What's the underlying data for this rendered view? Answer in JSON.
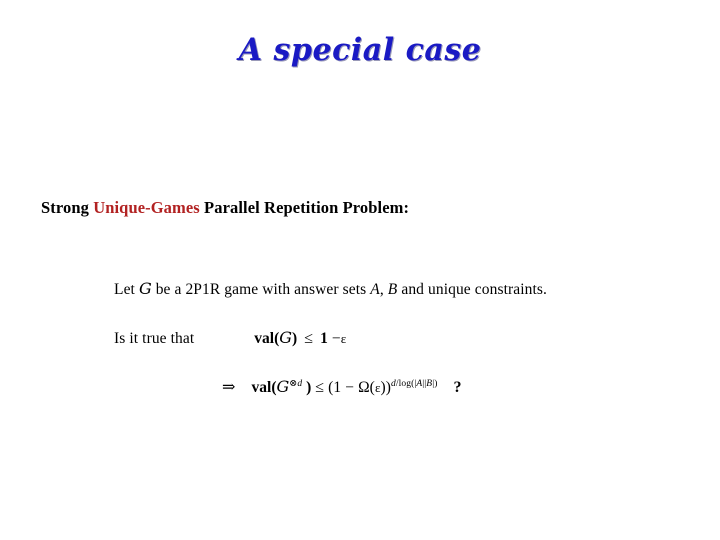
{
  "slide": {
    "background_color": "#ffffff",
    "title": {
      "text": "A special case",
      "color": "#1a1ac4",
      "shadow_color": "#9a9ab8"
    },
    "heading": {
      "prefix": "Strong ",
      "highlight": "Unique-Games",
      "highlight_color": "#b22222",
      "suffix": " Parallel Repetition Problem:"
    },
    "body": {
      "line1": {
        "part1": "Let ",
        "game_symbol": "G",
        "part2": " be a 2P1R game with answer sets ",
        "setA": "A",
        "comma": ", ",
        "setB": "B",
        "part3": " and unique constraints."
      },
      "line2": {
        "question": "Is it true that",
        "val_label": "val(",
        "game_symbol": "G",
        "close_paren": ")",
        "relation": "≤",
        "rhs_one": "1",
        "minus": "−",
        "epsilon": "ε"
      },
      "line3": {
        "implies": "⇒",
        "val_label": "val(",
        "game_symbol": "G",
        "tensor": "⊗",
        "tensor_exp": "d",
        "close_paren": " )",
        "relation": "≤",
        "open_paren": "(1 ",
        "minus": "−",
        "omega": "Ω(",
        "epsilon": "ε",
        "omega_close": "))",
        "exponent_num": "d",
        "exponent_slash": "/",
        "exponent_log": "log(|",
        "exponent_A": "A",
        "exponent_bar": "||",
        "exponent_B": "B",
        "exponent_end": "|)",
        "question_mark": "?"
      }
    }
  }
}
